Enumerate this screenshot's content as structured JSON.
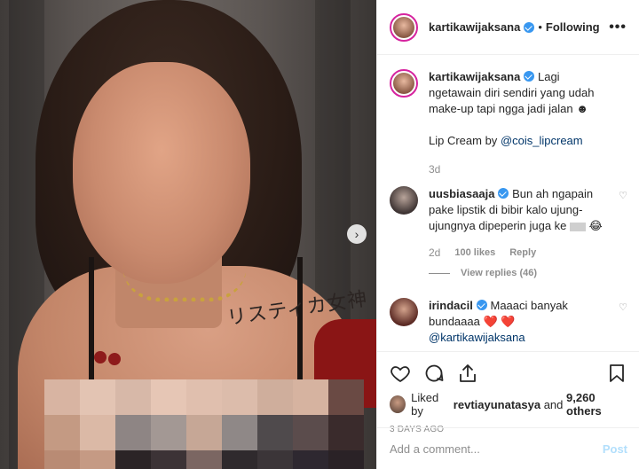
{
  "post": {
    "username": "kartikawijaksana",
    "following_label": "Following",
    "separator": "•",
    "more_label": "•••",
    "caption_line1": "Lagi ngetawain diri sendiri yang udah make-up tapi ngga jadi jalan",
    "caption_emoji": "☻",
    "caption_line2_prefix": "Lip Cream by",
    "caption_mention": "@cois_lipcream",
    "caption_age": "3d",
    "photo_tattoo_text": "リスティカ女神"
  },
  "comments": [
    {
      "username": "uusbiasaaja",
      "text": "Bun ah ngapain pake lipstik di bibir kalo ujung-ujungnya dipeperin juga ke",
      "emoji": "😂",
      "age": "2d",
      "likes": "100 likes",
      "reply_label": "Reply",
      "view_replies": "View replies (46)"
    },
    {
      "username": "irindacil",
      "text": "Maaaci banyak bundaaaa",
      "emoji": "❤️ ❤️",
      "mention": "@kartikawijaksana"
    }
  ],
  "actions": {
    "liked_prefix": "Liked by",
    "liked_user": "revtiayunatasya",
    "liked_and": "and",
    "liked_count": "9,260 others",
    "timestamp": "3 DAYS AGO"
  },
  "add_comment": {
    "placeholder": "Add a comment...",
    "post_label": "Post"
  },
  "colors": {
    "verified": "#3897f0",
    "mention": "#003569",
    "muted": "#8e8e8e",
    "post_disabled": "#b2dffc",
    "story_ring": "#d6249f"
  },
  "icons": {
    "next": "chevron-right-icon",
    "like": "heart-icon",
    "comment": "comment-bubble-icon",
    "share": "share-icon",
    "save": "bookmark-icon"
  }
}
